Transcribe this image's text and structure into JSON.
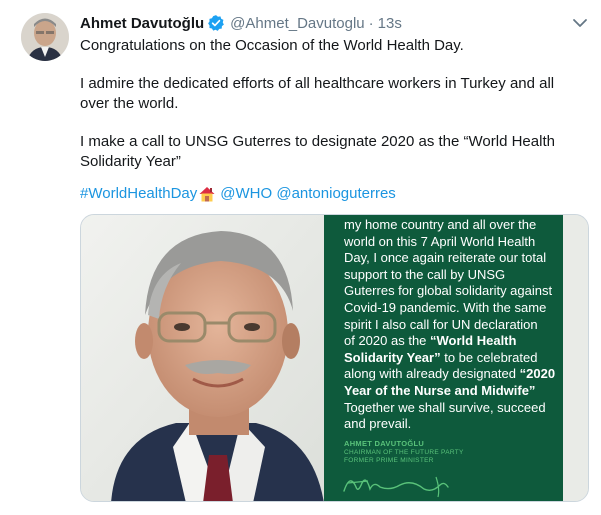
{
  "tweet": {
    "display_name": "Ahmet Davutoğlu",
    "handle": "@Ahmet_Davutoglu",
    "separator": "·",
    "time": "13s",
    "paragraphs": [
      "Congratulations on the Occasion of the World Health Day.",
      "I admire the dedicated efforts of all healthcare workers in Turkey and all over the world.",
      "I make a call to UNSG Guterres to designate 2020 as the “World Health Solidarity Year”"
    ],
    "hashtag": "#WorldHealthDay",
    "mentions": [
      "@WHO",
      "@antonioguterres"
    ]
  },
  "card": {
    "lines": [
      "my home country and all over the",
      "world on this 7 April World Health",
      "Day, I once again reiterate our total",
      "support to the call by UNSG",
      "Guterres for global solidarity against",
      "Covid-19 pandemic. With the same",
      "spirit I also call for UN declaration",
      "of 2020 as the "
    ],
    "bold_1": "“World Health Solidarity Year”",
    "after_bold_1": " to be celebrated along with  already designated",
    "bold_2": "“2020 Year of the Nurse and Midwife”",
    "after_bold_2": " Together we shall survive, succeed and prevail.",
    "sig_name": "AHMET DAVUTOĞLU",
    "sig_role_1": "CHAIRMAN OF THE FUTURE PARTY",
    "sig_role_2": "FORMER PRIME MINISTER"
  },
  "colors": {
    "link": "#1b95e0",
    "card_green": "#0e5a3c",
    "verified": "#1da1f2"
  },
  "icons": [
    "verified-badge-icon",
    "chevron-down-icon",
    "house-emoji-icon"
  ]
}
